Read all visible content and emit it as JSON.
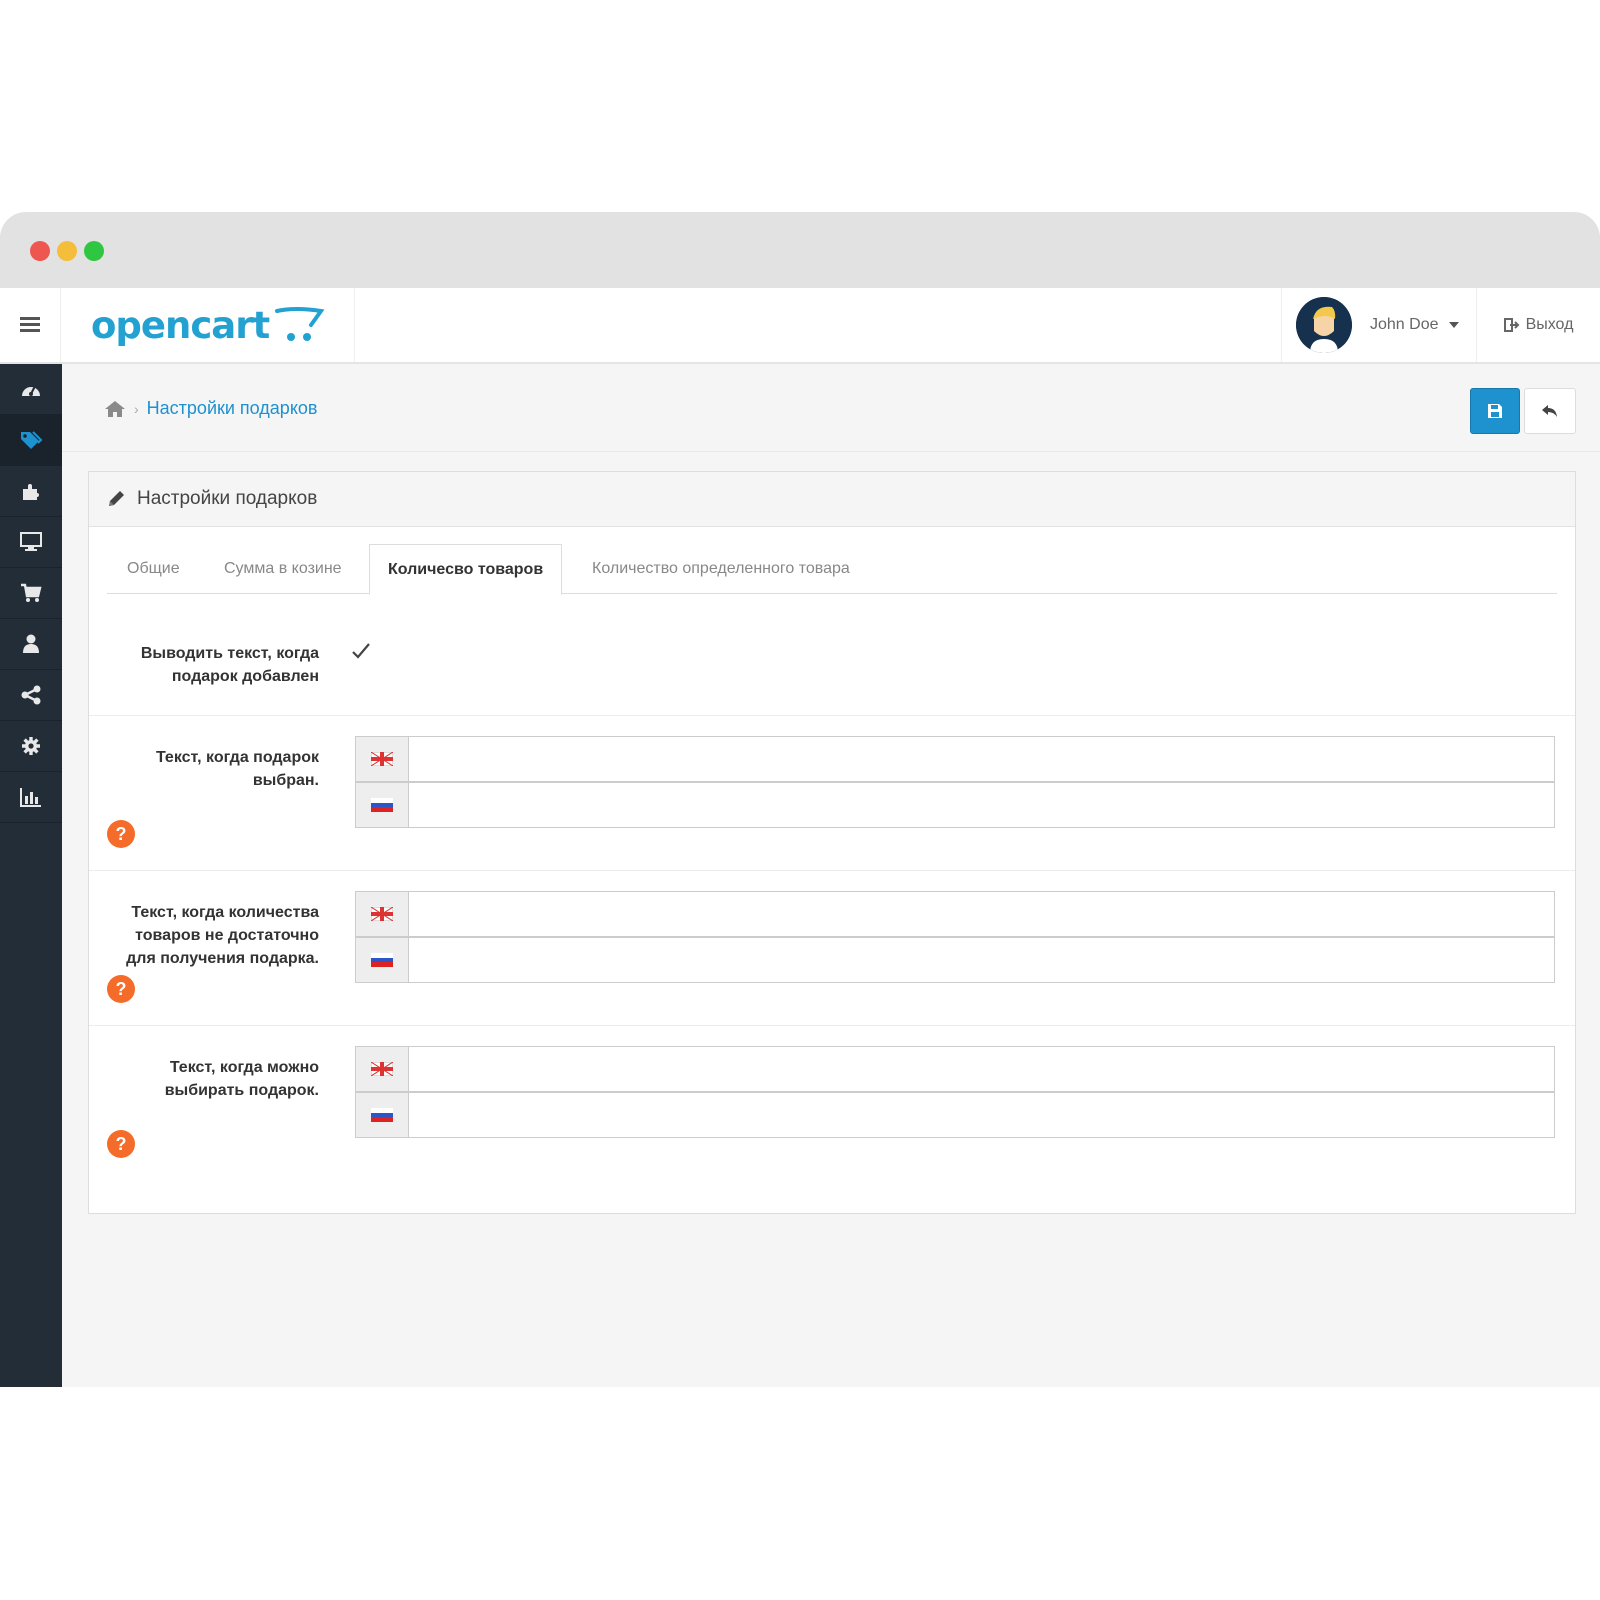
{
  "header": {
    "logo_text": "opencart",
    "user_name": "John Doe",
    "logout_label": "Выход"
  },
  "sidebar": {
    "items": [
      {
        "icon": "dashboard-icon"
      },
      {
        "icon": "tags-icon",
        "active": true
      },
      {
        "icon": "puzzle-icon"
      },
      {
        "icon": "desktop-icon"
      },
      {
        "icon": "cart-icon"
      },
      {
        "icon": "user-icon"
      },
      {
        "icon": "share-icon"
      },
      {
        "icon": "gear-icon"
      },
      {
        "icon": "bar-chart-icon"
      }
    ]
  },
  "breadcrumb": {
    "current": "Настройки подарков"
  },
  "panel": {
    "title": "Настройки подарков"
  },
  "tabs": [
    {
      "label": "Общие"
    },
    {
      "label": "Сумма в козине"
    },
    {
      "label": "Количесво товаров",
      "active": true
    },
    {
      "label": "Количество определенного товара"
    }
  ],
  "form": {
    "show_text": {
      "label_line1": "Выводить текст, когда",
      "label_line2": "подарок добавлен",
      "checked": true
    },
    "fields": [
      {
        "label_lines": [
          "Текст, когда подарок",
          "выбран."
        ],
        "value_en": "",
        "value_ru": ""
      },
      {
        "label_lines": [
          "Текст, когда количества",
          "товаров не достаточно",
          "для получения подарка."
        ],
        "value_en": "",
        "value_ru": ""
      },
      {
        "label_lines": [
          "Текст, когда можно",
          "выбирать подарок."
        ],
        "value_en": "",
        "value_ru": ""
      }
    ],
    "help_symbol": "?"
  },
  "colors": {
    "brand": "#23a1d1",
    "primary_button": "#1e91cf",
    "sidebar_bg": "#222d38",
    "help_badge": "#f56b2a"
  }
}
